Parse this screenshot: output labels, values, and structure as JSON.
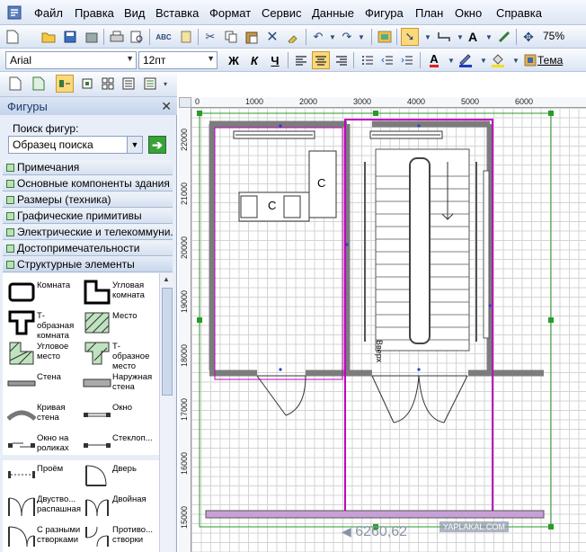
{
  "menubar": {
    "items": [
      "Файл",
      "Правка",
      "Вид",
      "Вставка",
      "Формат",
      "Сервис",
      "Данные",
      "Фигура",
      "План",
      "Окно",
      "Справка"
    ]
  },
  "toolbar": {
    "zoom": "75%"
  },
  "format_toolbar": {
    "font": "Arial",
    "size": "12пт",
    "bold": "Ж",
    "italic": "К",
    "underline": "Ч",
    "theme": "Тема",
    "text_color_glyph": "A"
  },
  "shapes_panel": {
    "title": "Фигуры",
    "search_label": "Поиск фигур:",
    "search_placeholder": "Образец поиска",
    "stencils": [
      "Примечания",
      "Основные компоненты здания",
      "Размеры (техника)",
      "Графические примитивы",
      "Электрические и телекоммуни...",
      "Достопримечательности",
      "Структурные элементы"
    ],
    "shapes": [
      [
        "Комната",
        "Угловая комната"
      ],
      [
        "Т-образная комната",
        "Место"
      ],
      [
        "Угловое место",
        "Т-образное место"
      ],
      [
        "Стена",
        "Наружная стена"
      ],
      [
        "Кривая стена",
        "Окно"
      ],
      [
        "Окно на роликах",
        "Стеклоп..."
      ],
      [
        "Проём",
        "Дверь"
      ],
      [
        "Двуство... распашная",
        "Двойная"
      ],
      [
        "С разными створками",
        "Противо... створки"
      ]
    ]
  },
  "ruler": {
    "h_labels": [
      "0",
      "1000",
      "2000",
      "3000",
      "4000",
      "5000",
      "6000"
    ],
    "v_labels": [
      "22000",
      "21000",
      "20000",
      "19000",
      "18000",
      "17000",
      "16000",
      "15000"
    ]
  },
  "drawing": {
    "label_c1": "C",
    "label_c2": "C",
    "stair_label": "Вверх"
  },
  "status": {
    "coords": "6260,62"
  },
  "watermark": "YAPLAKAL.COM"
}
